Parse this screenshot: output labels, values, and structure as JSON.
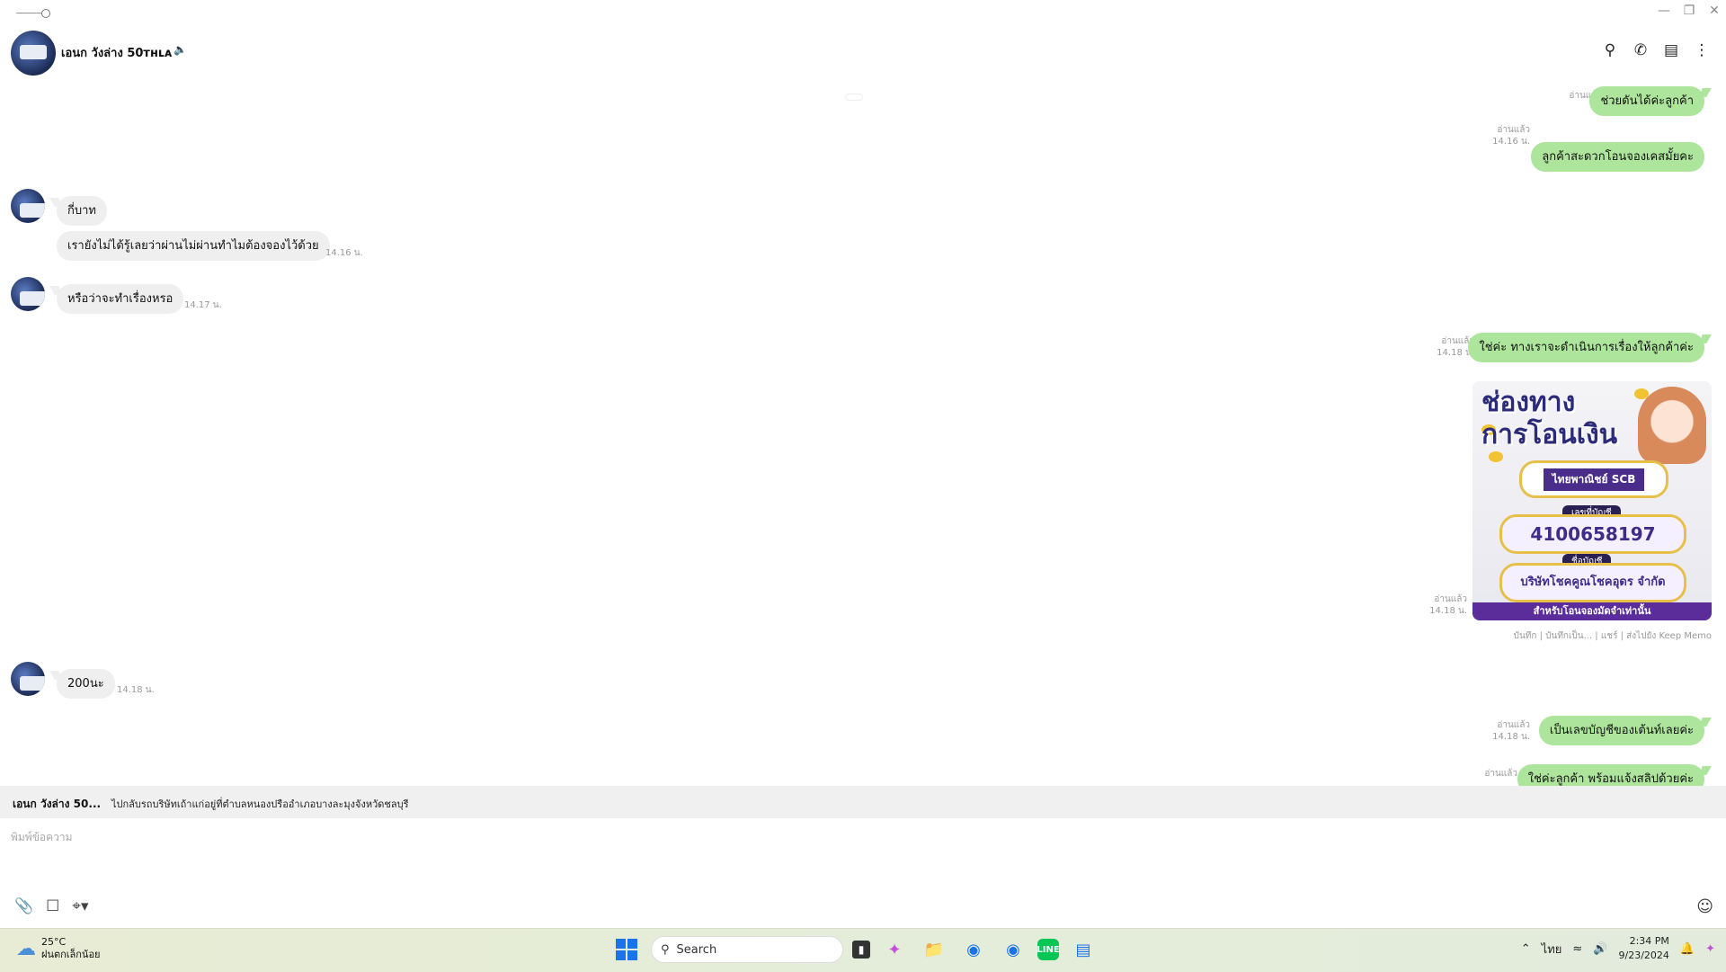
{
  "window": {
    "controls": [
      "minimize",
      "restore",
      "close"
    ]
  },
  "header": {
    "chat_name": "เอนก วังล่าง 50ᴛʜʟᴀ",
    "actions": [
      "search-icon",
      "phone-icon",
      "notes-icon",
      "more-icon"
    ]
  },
  "chat": {
    "date_divider": "",
    "messages": [
      {
        "dir": "out",
        "text": "ช่วยดันได้ค่ะลูกค้า",
        "read": "อ่านแล้ว",
        "time": ""
      },
      {
        "dir": "out",
        "text": "ลูกค้าสะดวกโอนจองเคสมั้ยคะ",
        "read": "อ่านแล้ว",
        "time": "14.16 น."
      },
      {
        "dir": "in",
        "text": "กี่บาท",
        "time": ""
      },
      {
        "dir": "in",
        "text": "เรายังไม่ได้รู้เลยว่าผ่านไม่ผ่านทำไมต้องจองไว้ด้วย",
        "time": "14.16 น."
      },
      {
        "dir": "in",
        "text": "หรือว่าจะทำเรื่องหรอ",
        "time": "14.17 น."
      },
      {
        "dir": "out",
        "text": "ใช่ค่ะ ทางเราจะดำเนินการเรื่องให้ลูกค้าค่ะ",
        "read": "อ่านแล้ว",
        "time": "14.18 น."
      },
      {
        "dir": "out",
        "type": "image",
        "read": "อ่านแล้ว",
        "time": "14.18 น."
      },
      {
        "dir": "in",
        "text": "200นะ",
        "time": "14.18 น."
      },
      {
        "dir": "out",
        "text": "เป็นเลขบัญชีของเต้นท์เลยค่ะ",
        "read": "อ่านแล้ว",
        "time": "14.18 น."
      },
      {
        "dir": "out",
        "text": "ใช่ค่ะลูกค้า พร้อมแจ้งสลิปด้วยค่ะ",
        "read": "อ่านแล้ว",
        "time": ""
      },
      {
        "dir": "out",
        "text": "",
        "read": "",
        "time": ""
      }
    ],
    "image": {
      "title_line1": "ช่องทาง",
      "title_line2": "การโอนเงิน",
      "bank": "ไทยพาณิชย์ SCB",
      "account_label": "เลขที่บัญชี",
      "account_number": "4100658197",
      "name_label": "ชื่อบัญชี",
      "account_name": "บริษัทโชคคูณโชคอุดร จำกัด",
      "footer": "สำหรับโอนจองมัดจำเท่านั้น",
      "actions": "บันทึก | บันทึกเป็น... | แชร์ | ส่งไปยัง Keep Memo"
    }
  },
  "reply_bar": {
    "name": "เอนก วังล่าง 50...",
    "text": "ไปกลับรถบริษัทเถ้าแก่อยู่ที่ตำบลหนองปรืออำเภอบางละมุงจังหวัดชลบุรี"
  },
  "composer": {
    "placeholder": "พิมพ์ข้อความ",
    "tools": [
      "paperclip-icon",
      "bookmark-icon",
      "crop-icon"
    ]
  },
  "taskbar": {
    "temp": "25°C",
    "weather": "ฝนตกเล็กน้อย",
    "search_placeholder": "Search",
    "lang": "ไทย",
    "time": "2:34 PM",
    "date": "9/23/2024",
    "colors": {
      "accent": "#1a73e8",
      "line_green": "#06c755"
    }
  }
}
